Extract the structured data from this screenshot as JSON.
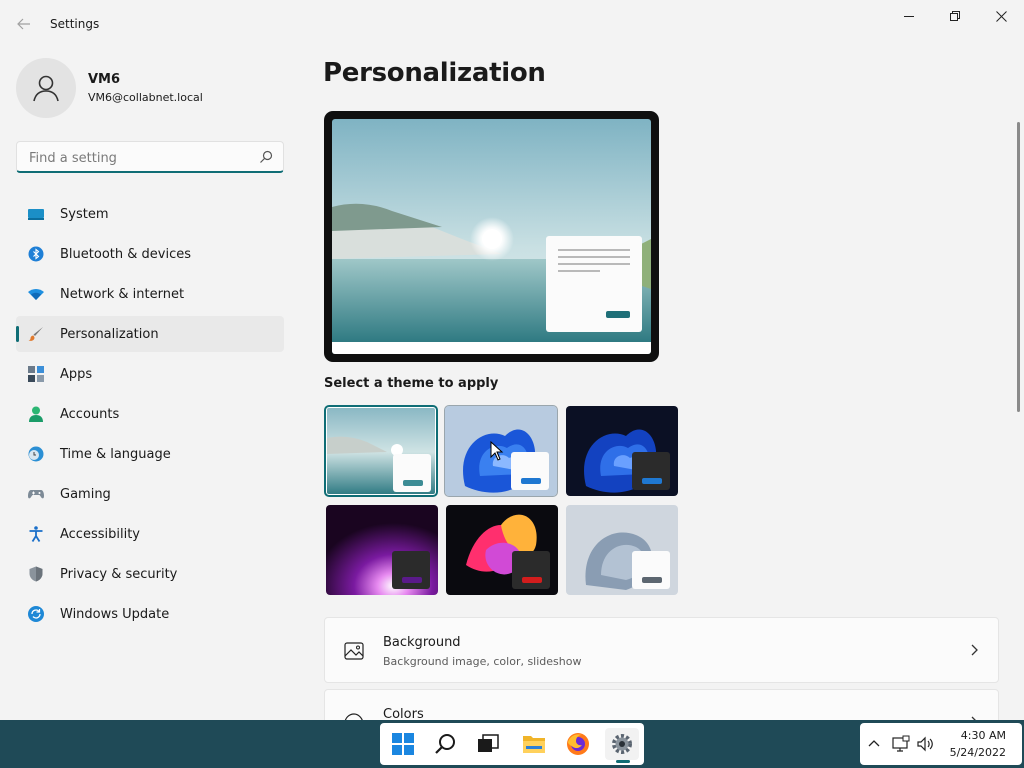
{
  "window": {
    "title": "Settings"
  },
  "user": {
    "name": "VM6",
    "email": "VM6@collabnet.local"
  },
  "search": {
    "placeholder": "Find a setting"
  },
  "nav": {
    "items": [
      {
        "label": "System",
        "icon": "monitor-icon",
        "active": false
      },
      {
        "label": "Bluetooth & devices",
        "icon": "bluetooth-icon",
        "active": false
      },
      {
        "label": "Network & internet",
        "icon": "wifi-icon",
        "active": false
      },
      {
        "label": "Personalization",
        "icon": "brush-icon",
        "active": true
      },
      {
        "label": "Apps",
        "icon": "apps-icon",
        "active": false
      },
      {
        "label": "Accounts",
        "icon": "person-icon",
        "active": false
      },
      {
        "label": "Time & language",
        "icon": "clock-globe-icon",
        "active": false
      },
      {
        "label": "Gaming",
        "icon": "gamepad-icon",
        "active": false
      },
      {
        "label": "Accessibility",
        "icon": "accessibility-icon",
        "active": false
      },
      {
        "label": "Privacy & security",
        "icon": "shield-icon",
        "active": false
      },
      {
        "label": "Windows Update",
        "icon": "update-icon",
        "active": false
      }
    ]
  },
  "main": {
    "title": "Personalization",
    "themes_label": "Select a theme to apply",
    "themes": [
      {
        "name": "Windows (light) lake",
        "selected": true
      },
      {
        "name": "Windows (light) bloom",
        "selected": false
      },
      {
        "name": "Windows (dark) bloom",
        "selected": false
      },
      {
        "name": "Glow",
        "selected": false
      },
      {
        "name": "Captured Motion",
        "selected": false
      },
      {
        "name": "Flow",
        "selected": false
      }
    ],
    "cards": [
      {
        "title": "Background",
        "subtitle": "Background image, color, slideshow",
        "icon": "image-icon"
      },
      {
        "title": "Colors",
        "subtitle": "",
        "icon": "palette-icon"
      }
    ]
  },
  "taskbar": {
    "apps": [
      "start-icon",
      "search-icon",
      "task-view-icon",
      "file-explorer-icon",
      "firefox-icon",
      "settings-icon"
    ],
    "time": "4:30 AM",
    "date": "5/24/2022"
  },
  "colors": {
    "accent": "#0f6d75",
    "taskbar": "#1f4a57"
  }
}
